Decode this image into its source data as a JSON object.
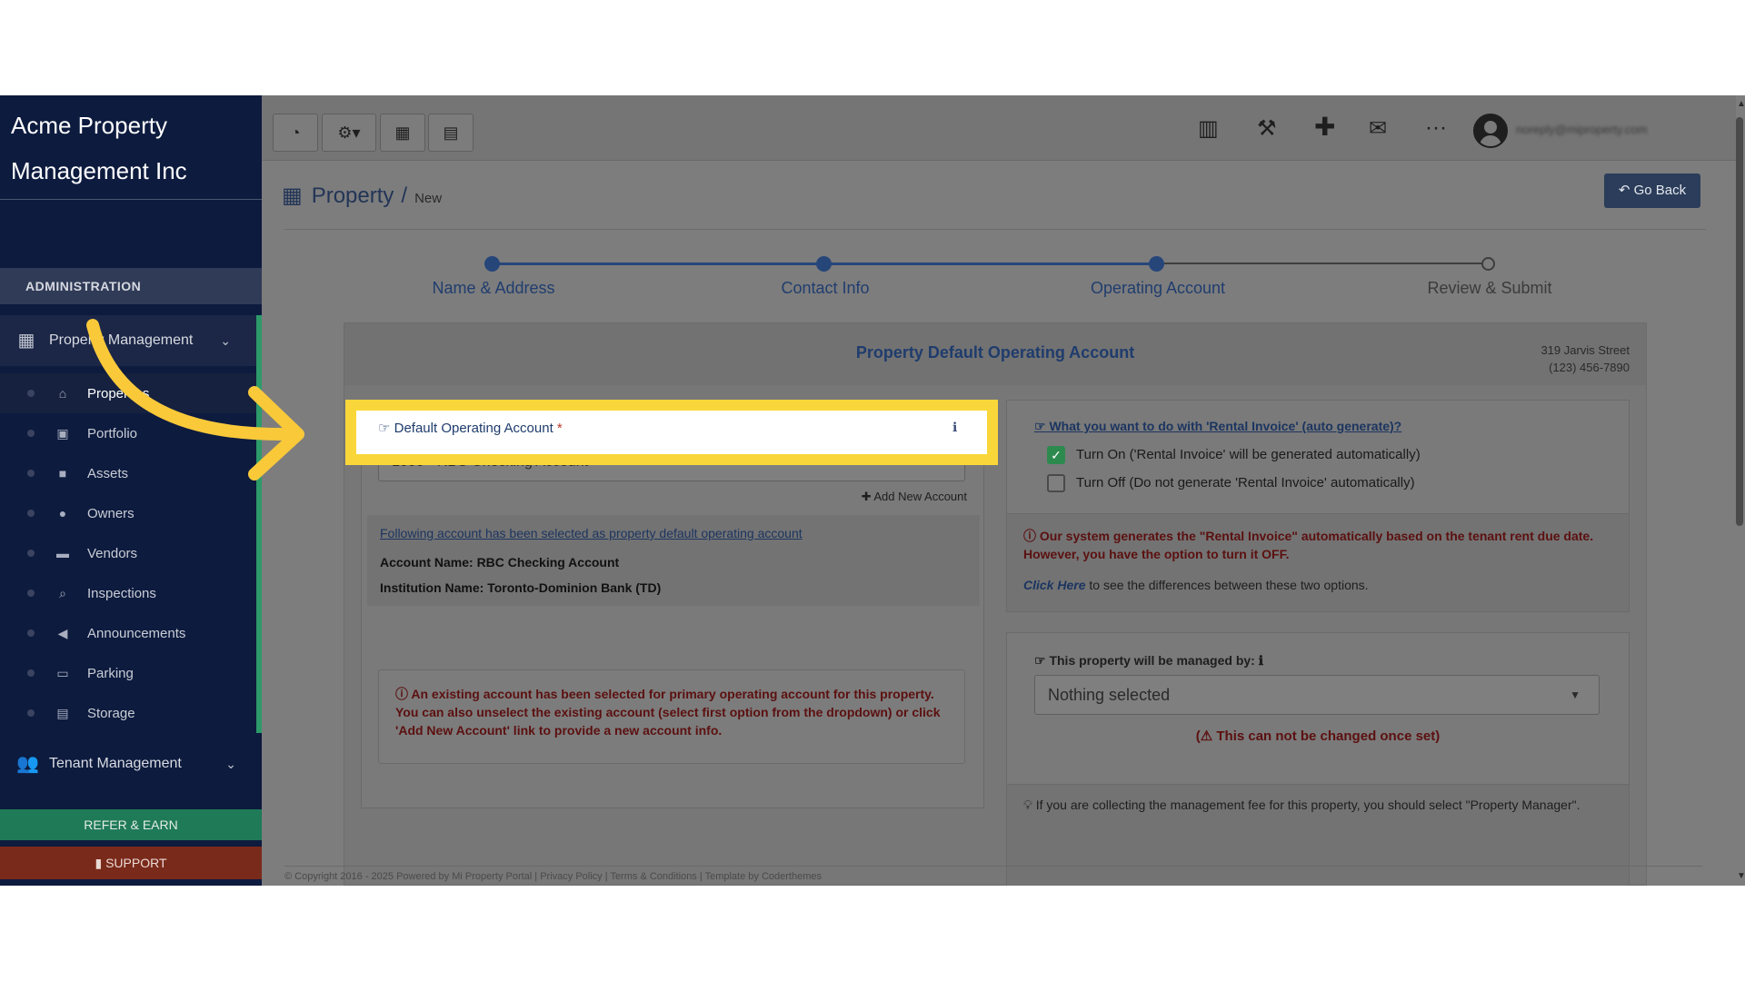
{
  "sidebar": {
    "brand_line1": "Acme Property",
    "brand_line2": "Management Inc",
    "section_header": "ADMINISTRATION",
    "groups": {
      "property_management": "Property Management",
      "tenant_management": "Tenant Management"
    },
    "items": [
      "Properties",
      "Portfolio",
      "Assets",
      "Owners",
      "Vendors",
      "Inspections",
      "Announcements",
      "Parking",
      "Storage"
    ],
    "refer_label": "REFER & EARN",
    "support_label": "SUPPORT"
  },
  "topbar": {
    "user_email": "noreply@miproperty.com"
  },
  "page": {
    "title": "Property",
    "separator": "/",
    "subtitle": "New",
    "go_back": "Go Back"
  },
  "stepper": {
    "steps": [
      "Name & Address",
      "Contact Info",
      "Operating Account",
      "Review & Submit"
    ]
  },
  "card": {
    "title": "Property Default Operating Account",
    "address_line1": "319 Jarvis Street",
    "address_line2": "(123) 456-7890"
  },
  "account_panel": {
    "label": "Default Operating Account",
    "required_mark": "*",
    "selected_value": "1000 - RBC Checking Account",
    "add_new": "Add New Account",
    "selected_note": "Following account has been selected as property default operating account",
    "account_name": "Account Name: RBC Checking Account",
    "institution_name": "Institution Name: Toronto-Dominion Bank (TD)",
    "info_text": "An existing account has been selected for primary operating account for this property. You can also unselect the existing account (select first option from the dropdown) or click 'Add New Account' link to provide a new account info."
  },
  "invoice_panel": {
    "question": "What you want to do with 'Rental Invoice' (auto generate)?",
    "option_on": "Turn On ('Rental Invoice' will be generated automatically)",
    "option_off": "Turn Off (Do not generate 'Rental Invoice' automatically)",
    "option_on_checked": true,
    "notice": "Our system generates the \"Rental Invoice\" automatically based on the tenant rent due date. However, you have the option to turn it OFF.",
    "click_here": "Click Here",
    "click_here_rest": " to see the differences between these two options."
  },
  "managed_panel": {
    "label": "This property will be managed by:",
    "select_value": "Nothing selected",
    "warning": "This can not be changed once set)",
    "warning_prefix": "(",
    "tip": "If you are collecting the management fee for this property, you should select \"Property Manager\"."
  },
  "footer": {
    "text": "© Copyright 2016 - 2025 Powered by Mi Property Portal | Privacy Policy | Terms & Conditions | Template by Coderthemes"
  },
  "colors": {
    "sidebar_bg": "#0d1b3e",
    "accent_green": "#2d9a6a",
    "highlight_yellow": "#f9d73a",
    "arrow_yellow": "#f9c93a",
    "step_blue": "#26467a"
  }
}
